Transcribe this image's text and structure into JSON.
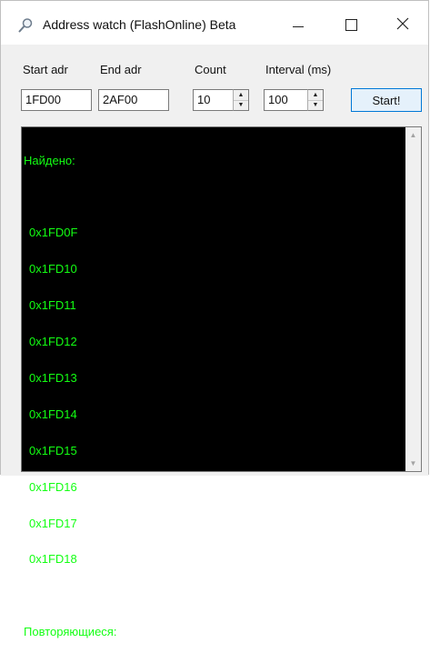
{
  "window": {
    "title": "Address watch (FlashOnline) Beta",
    "icon": "magnifier-icon",
    "minimize_glyph": "—",
    "maximize_glyph": "☐",
    "close_glyph": "✕"
  },
  "labels": {
    "start_adr": "Start adr",
    "end_adr": "End adr",
    "count": "Count",
    "interval": "Interval (ms)"
  },
  "inputs": {
    "start_adr": "1FD00",
    "end_adr": "2AF00",
    "count": "10",
    "interval": "100"
  },
  "buttons": {
    "start": "Start!"
  },
  "output": {
    "found_heading": "Найдено:",
    "addresses": [
      "0x1FD0F",
      "0x1FD10",
      "0x1FD11",
      "0x1FD12",
      "0x1FD13",
      "0x1FD14",
      "0x1FD15",
      "0x1FD16",
      "0x1FD17",
      "0x1FD18"
    ],
    "repeating_heading": "Повторяющиеся:",
    "text_color": "#13ff13",
    "background_color": "#000000"
  },
  "colors": {
    "accent": "#0078d7",
    "button_bg": "#e5f1fb",
    "window_bg": "#f0f0f0"
  }
}
